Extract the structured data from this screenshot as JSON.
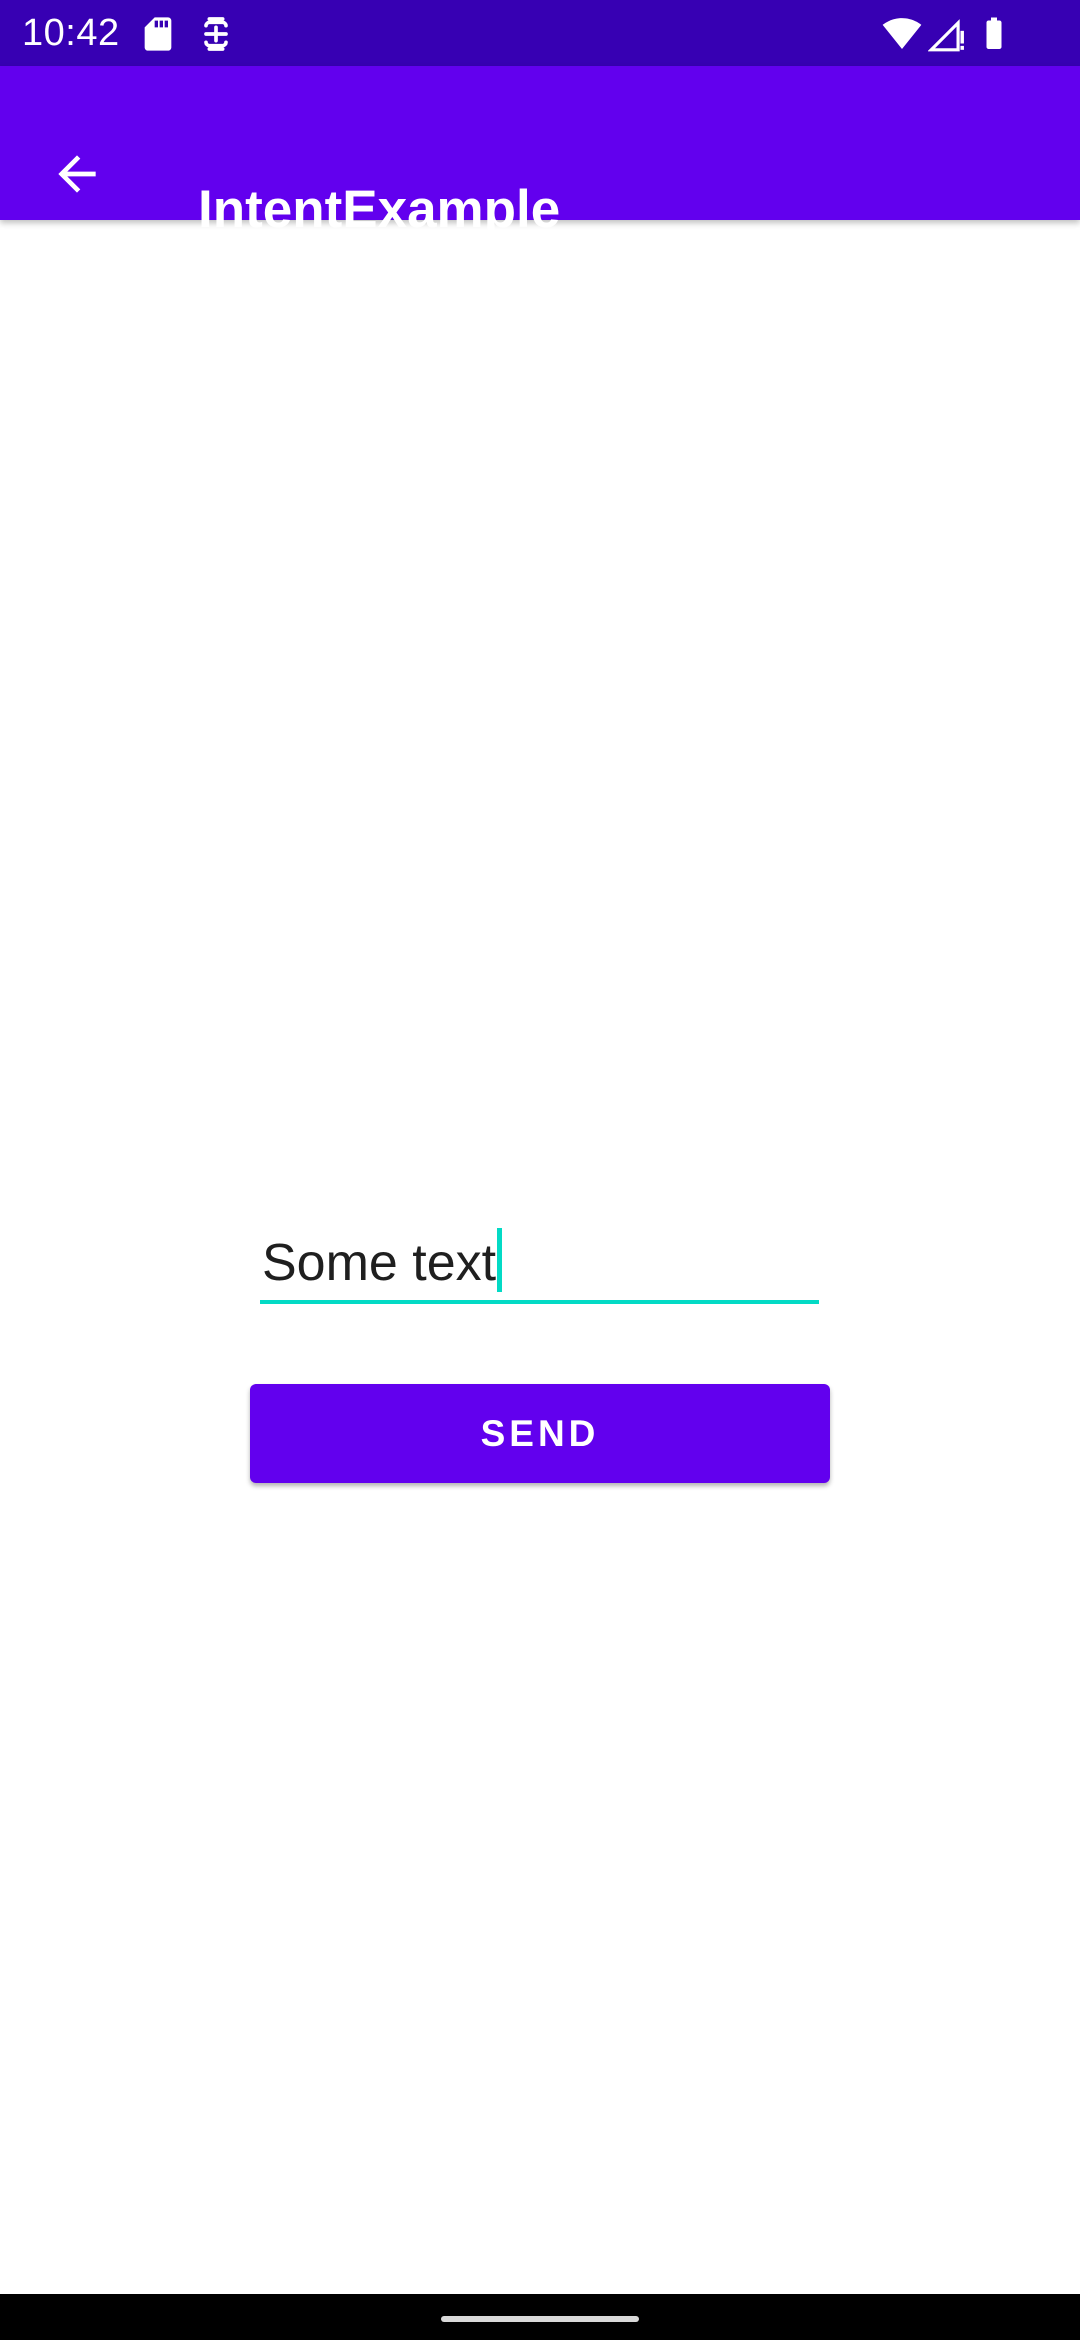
{
  "status_bar": {
    "time": "10:42",
    "icons_left": [
      "sd-card-icon",
      "face-unlock-icon"
    ],
    "icons_right": [
      "wifi-icon",
      "cell-signal-icon",
      "battery-icon"
    ]
  },
  "app_bar": {
    "back_icon": "arrow-back-icon",
    "title": "IntentExample"
  },
  "main": {
    "text_field": {
      "value": "Some text"
    },
    "send_button": {
      "label": "SEND"
    }
  },
  "colors": {
    "status_bar": "#3700B3",
    "primary": "#6200EE",
    "accent": "#03DAC5",
    "background": "#FFFFFF"
  }
}
